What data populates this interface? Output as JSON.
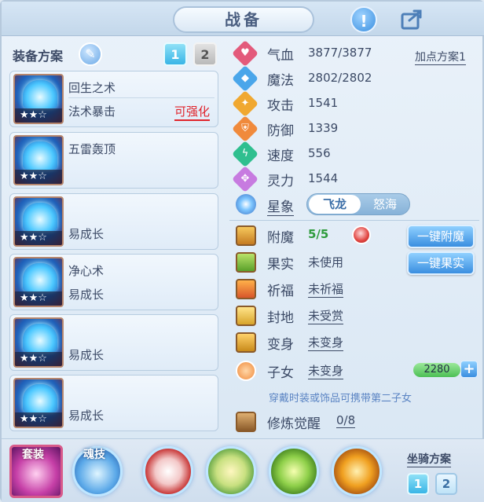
{
  "header": {
    "title": "战备",
    "info_icon": "!",
    "share_icon": "share-icon"
  },
  "left": {
    "title": "装备方案",
    "scheme_buttons": [
      "1",
      "2"
    ],
    "equipments": [
      {
        "name": "回生之术",
        "effect": "法术暴击",
        "action": "可强化",
        "stars": "★★☆"
      },
      {
        "name": "五雷轰顶",
        "effect": "",
        "action": "",
        "stars": "★★☆"
      },
      {
        "name": "",
        "effect": "易成长",
        "action": "",
        "stars": "★★☆"
      },
      {
        "name": "净心术",
        "effect": "易成长",
        "action": "",
        "stars": "★★☆"
      },
      {
        "name": "",
        "effect": "易成长",
        "action": "",
        "stars": "★★☆"
      },
      {
        "name": "",
        "effect": "易成长",
        "action": "",
        "stars": "★★☆"
      }
    ]
  },
  "stats": {
    "add_point": "加点方案1",
    "rows": [
      {
        "label": "气血",
        "value": "3877/3877",
        "color": "#e35a7b",
        "glyph": "♥"
      },
      {
        "label": "魔法",
        "value": "2802/2802",
        "color": "#4aa6ea",
        "glyph": "◆"
      },
      {
        "label": "攻击",
        "value": "1541",
        "color": "#f0a830",
        "glyph": "✦"
      },
      {
        "label": "防御",
        "value": "1339",
        "color": "#f08a3c",
        "glyph": "⛨"
      },
      {
        "label": "速度",
        "value": "556",
        "color": "#2fbf8f",
        "glyph": "ϟ"
      },
      {
        "label": "灵力",
        "value": "1544",
        "color": "#c77be0",
        "glyph": "✥"
      }
    ],
    "star_label": "星象",
    "star_toggle": [
      "飞龙",
      "怒海"
    ]
  },
  "features": {
    "rows": [
      {
        "label": "附魔",
        "value": "5/5"
      },
      {
        "label": "果实",
        "value": "未使用"
      },
      {
        "label": "祈福",
        "value": "未祈福"
      },
      {
        "label": "封地",
        "value": "未受赏"
      },
      {
        "label": "变身",
        "value": "未变身"
      },
      {
        "label": "子女",
        "value": "未变身"
      }
    ],
    "buttons": [
      "一键附魔",
      "一键果实"
    ],
    "child_value": "2280",
    "hint": "穿戴时装或饰品可携带第二子女",
    "cultivation_label": "修炼觉醒",
    "cultivation_value": "0/8"
  },
  "bottom": {
    "suit_label": "套装",
    "soul_label": "魂技",
    "mount_title": "坐骑方案",
    "mount_buttons": [
      "1",
      "2"
    ]
  }
}
